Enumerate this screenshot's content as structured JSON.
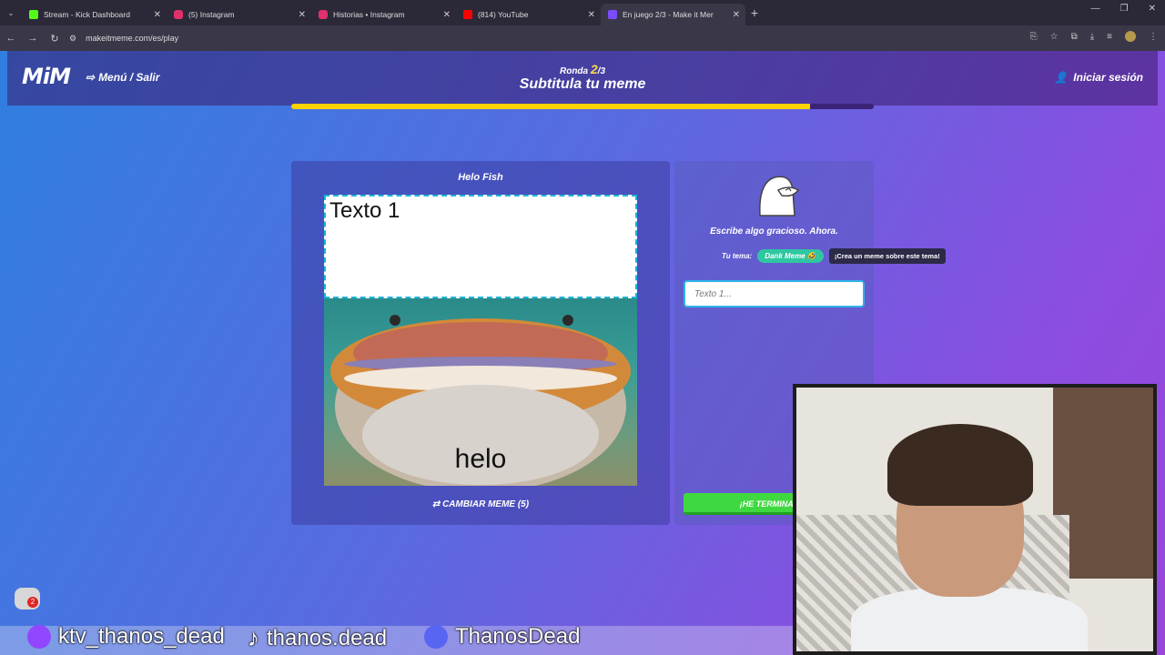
{
  "browser": {
    "tabs": [
      {
        "title": "Stream - Kick Dashboard",
        "color": "#53fc18"
      },
      {
        "title": "(5) Instagram",
        "color": "#e1306c"
      },
      {
        "title": "Historias • Instagram",
        "color": "#e1306c"
      },
      {
        "title": "(814) YouTube",
        "color": "#ff0000"
      },
      {
        "title": "En juego 2/3 - Make it Mer",
        "color": "#7a4cff"
      }
    ],
    "url": "makeitmeme.com/es/play"
  },
  "header": {
    "logo": "MiM",
    "menu_label": "Menú / Salir",
    "round_label": "Ronda",
    "round_current": "2",
    "round_total": "/3",
    "phase_title": "Subtitula tu meme",
    "login_label": "Iniciar sesión",
    "progress": 0.89
  },
  "meme": {
    "name": "Helo Fish",
    "text_box_label": "Texto 1",
    "image_caption": "helo",
    "change_label": "CAMBIAR MEME (5)"
  },
  "editor": {
    "prompt": "Escribe algo gracioso. Ahora.",
    "theme_label": "Tu tema:",
    "theme_value": "Dank Meme",
    "theme_tooltip": "¡Crea un meme sobre este tema!",
    "input_placeholder": "Texto 1...",
    "done_label": "¡HE TERMINADO!"
  },
  "overlay": {
    "chat_badge": "2",
    "socials": [
      "ktv_thanos_dead",
      "thanos.dead",
      "ThanosDead"
    ]
  },
  "colors": {
    "accent": "#ffd200",
    "done": "#40d840",
    "input_border": "#2fb4e8",
    "theme_pill": "#2ec7a0"
  }
}
